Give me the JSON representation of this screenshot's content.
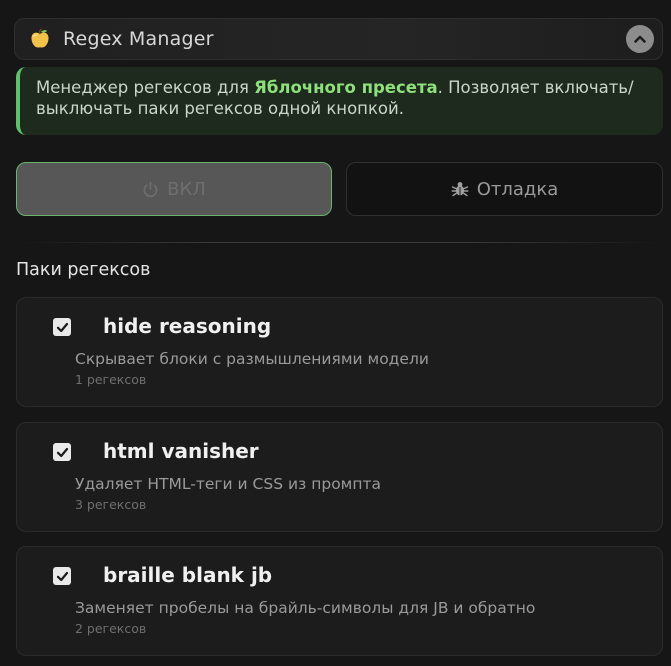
{
  "header": {
    "title": "Regex Manager",
    "icon": "apple-icon",
    "collapse_icon": "chevron-up-icon"
  },
  "info": {
    "text_before": "Менеджер регексов для ",
    "highlight": "Яблочного пресета",
    "text_after": ". Позволяет включать/выключать паки регексов одной кнопкой.",
    "accent_color": "#5fbf6a"
  },
  "buttons": {
    "toggle_label": "ВКЛ",
    "toggle_icon": "power-icon",
    "debug_label": "Отладка",
    "debug_icon": "bug-icon"
  },
  "packs": {
    "title": "Паки регексов",
    "items": [
      {
        "name": "hide reasoning",
        "description": "Скрывает блоки с размышлениями модели",
        "count": "1 регексов",
        "checked": true
      },
      {
        "name": "html vanisher",
        "description": "Удаляет HTML-теги и CSS из промпта",
        "count": "3 регексов",
        "checked": true
      },
      {
        "name": "braille blank jb",
        "description": "Заменяет пробелы на брайль-символы для JB и обратно",
        "count": "2 регексов",
        "checked": true
      }
    ]
  }
}
